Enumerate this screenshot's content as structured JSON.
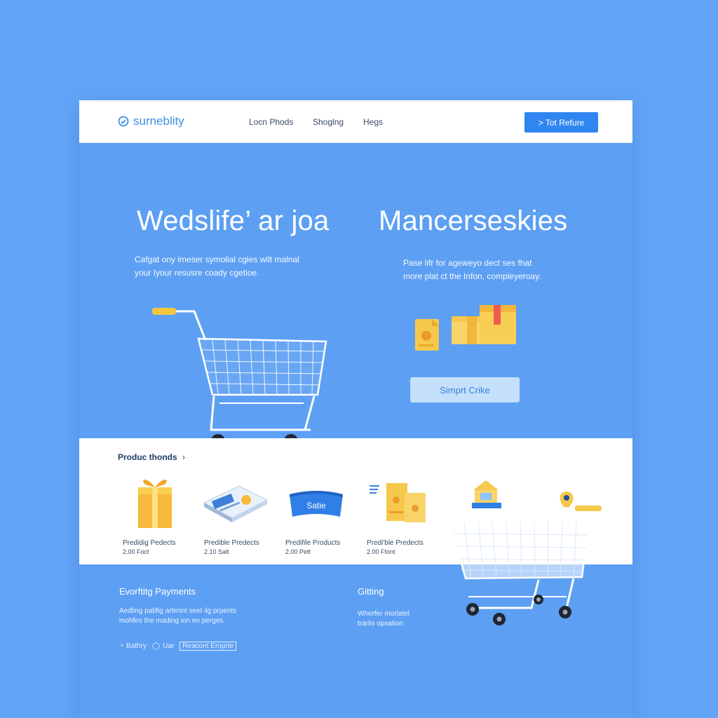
{
  "header": {
    "logo_text": "surneblity",
    "logo_icon": "logo-icon",
    "nav": [
      "Locn Phods",
      "Shoglng",
      "Hegs"
    ],
    "cta_label": "> Tot Refure"
  },
  "hero": {
    "left_title": "Wedslife’ ar joa",
    "left_desc_line1": "Cafgat ony imeser symolial cgles wilt malnal",
    "left_desc_line2": "your Iyour resusre coady cgetioe.",
    "right_title": "Mancerseskies",
    "right_desc_line1": "Pase lifr for ageweyo dect ses fhat",
    "right_desc_line2": "more plat ct the Infon, compleyeroay.",
    "button_label": "Simprt Crike"
  },
  "products": {
    "heading": "Produc thonds",
    "items": [
      {
        "name": "Predidig Pedects",
        "price": "2.00 Foct",
        "icon": "gift-box-icon"
      },
      {
        "name": "Predible Predects",
        "price": "2.10 Salt",
        "icon": "product-tray-icon"
      },
      {
        "name": "Predifile Products",
        "price": "2.00 Pett",
        "icon": "sale-tag-icon",
        "badge": "Satie"
      },
      {
        "name": "Predi'ble Predects",
        "price": "2.00 Ftont",
        "icon": "document-icon"
      },
      {
        "name": "",
        "price": "",
        "icon": "store-icon"
      }
    ]
  },
  "footer": {
    "left_heading": "Evorftitg Payments",
    "left_text_line1": "Aedling patifig arferint seet ilg prpents",
    "left_text_line2": "mohfes the mading ion en perges.",
    "right_heading": "Gitting",
    "right_text_line1": "Wherfer morlatel",
    "right_text_line2": "trarlis opsation",
    "links": [
      "Bathry",
      "Uar",
      "Reacont Eroprte"
    ]
  },
  "colors": {
    "background": "#62a4f7",
    "accent": "#2f86f0",
    "gold": "#f6c84b"
  }
}
